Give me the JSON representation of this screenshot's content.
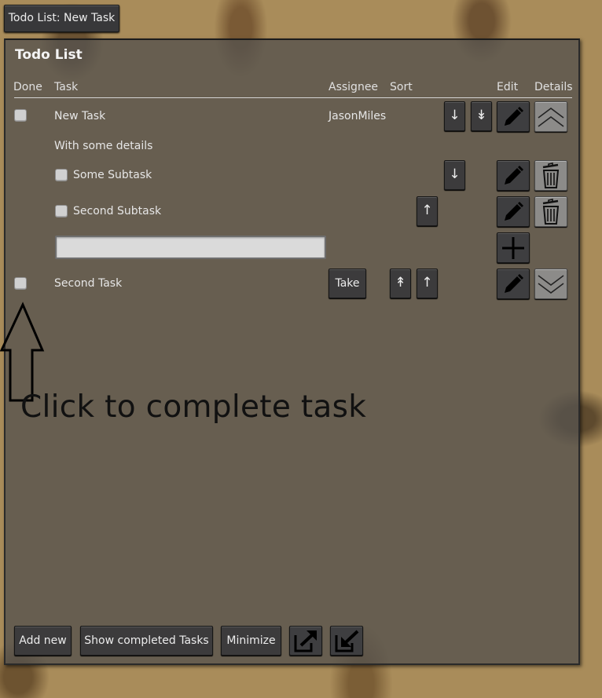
{
  "window_button": {
    "label": "Todo List: New Task"
  },
  "panel": {
    "title": "Todo List",
    "headers": {
      "done": "Done",
      "task": "Task",
      "assignee": "Assignee",
      "sort": "Sort",
      "edit": "Edit",
      "details": "Details"
    },
    "tasks": [
      {
        "name": "New Task",
        "assignee": "JasonMiles",
        "done": false,
        "details_expanded": true,
        "description": "With some details",
        "subtasks": [
          {
            "name": "Some Subtask",
            "done": false
          },
          {
            "name": "Second Subtask",
            "done": false
          }
        ],
        "new_subtask_value": ""
      },
      {
        "name": "Second Task",
        "assignee_button": "Take",
        "done": false,
        "details_expanded": false
      }
    ],
    "footer": {
      "add_new": "Add new",
      "show_completed": "Show completed Tasks",
      "minimize": "Minimize",
      "export_icon": "export-icon",
      "import_icon": "import-icon"
    }
  },
  "annotation": {
    "text": "Click to complete task"
  },
  "icons": {
    "edit": "pencil-icon",
    "delete": "trash-icon",
    "add": "plus-icon",
    "collapse": "chevron-up-icon",
    "expand": "chevron-down-icon",
    "move_down": "arrow-down-icon",
    "move_bottom": "arrow-to-bottom-icon",
    "move_up": "arrow-up-icon",
    "move_top": "arrow-to-top-icon"
  }
}
